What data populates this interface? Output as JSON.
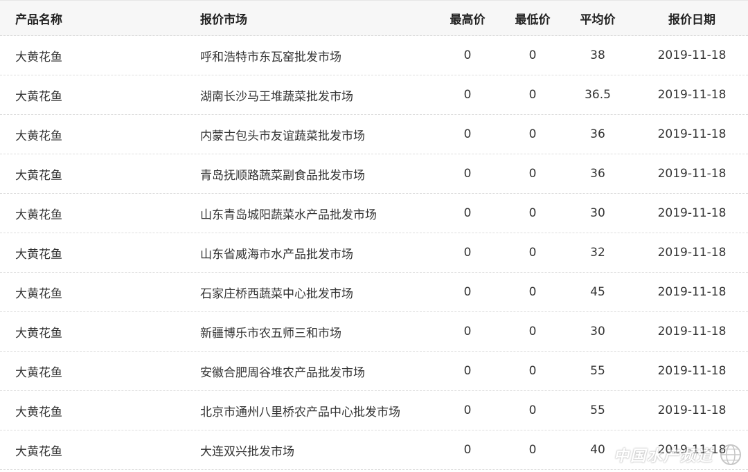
{
  "table": {
    "headers": {
      "name": "产品名称",
      "market": "报价市场",
      "high": "最高价",
      "low": "最低价",
      "avg": "平均价",
      "date": "报价日期"
    },
    "rows": [
      {
        "name": "大黄花鱼",
        "market": "呼和浩特市东瓦窑批发市场",
        "high": "0",
        "low": "0",
        "avg": "38",
        "date": "2019-11-18"
      },
      {
        "name": "大黄花鱼",
        "market": "湖南长沙马王堆蔬菜批发市场",
        "high": "0",
        "low": "0",
        "avg": "36.5",
        "date": "2019-11-18"
      },
      {
        "name": "大黄花鱼",
        "market": "内蒙古包头市友谊蔬菜批发市场",
        "high": "0",
        "low": "0",
        "avg": "36",
        "date": "2019-11-18"
      },
      {
        "name": "大黄花鱼",
        "market": "青岛抚顺路蔬菜副食品批发市场",
        "high": "0",
        "low": "0",
        "avg": "36",
        "date": "2019-11-18"
      },
      {
        "name": "大黄花鱼",
        "market": "山东青岛城阳蔬菜水产品批发市场",
        "high": "0",
        "low": "0",
        "avg": "30",
        "date": "2019-11-18"
      },
      {
        "name": "大黄花鱼",
        "market": "山东省威海市水产品批发市场",
        "high": "0",
        "low": "0",
        "avg": "32",
        "date": "2019-11-18"
      },
      {
        "name": "大黄花鱼",
        "market": "石家庄桥西蔬菜中心批发市场",
        "high": "0",
        "low": "0",
        "avg": "45",
        "date": "2019-11-18"
      },
      {
        "name": "大黄花鱼",
        "market": "新疆博乐市农五师三和市场",
        "high": "0",
        "low": "0",
        "avg": "30",
        "date": "2019-11-18"
      },
      {
        "name": "大黄花鱼",
        "market": "安徽合肥周谷堆农产品批发市场",
        "high": "0",
        "low": "0",
        "avg": "55",
        "date": "2019-11-18"
      },
      {
        "name": "大黄花鱼",
        "market": "北京市通州八里桥农产品中心批发市场",
        "high": "0",
        "low": "0",
        "avg": "55",
        "date": "2019-11-18"
      },
      {
        "name": "大黄花鱼",
        "market": "大连双兴批发市场",
        "high": "0",
        "low": "0",
        "avg": "40",
        "date": "2019-11-18"
      }
    ]
  },
  "watermark": {
    "text": "中国水产频道",
    "icon": "globe-logo-icon"
  },
  "colors": {
    "header_bg": "#f7f7f7",
    "text": "#333333",
    "divider": "#dcdcdc"
  }
}
